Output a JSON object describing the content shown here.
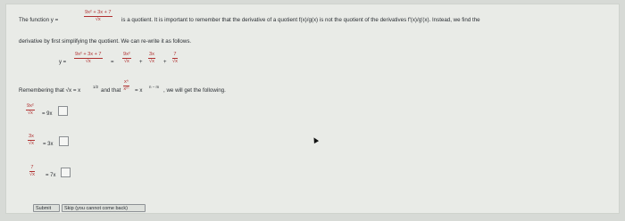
{
  "intro": {
    "prefix": "The function y =",
    "num": "9x² + 3x + 7",
    "den": "√x",
    "suffix": "is a quotient. It is important to remember that the derivative of a quotient f(x)/g(x) is not the quotient of the derivatives f′(x)/g′(x). Instead, we find the"
  },
  "line2": "derivative by first simplifying the quotient. We can re-write it as follows.",
  "eq1": {
    "lhs": "y =",
    "f1_num": "9x² + 3x + 7",
    "f1_den": "√x",
    "eq": "=",
    "f2_num": "9x²",
    "f2_den": "√x",
    "plus1": "+",
    "f3_num": "3x",
    "f3_den": "√x",
    "plus2": "+",
    "f4_num": "7",
    "f4_den": "√x"
  },
  "remember": {
    "a": "Remembering that √x = x",
    "a_exp": "1/2",
    "b": "and that",
    "frac_num": "xⁿ",
    "frac_den": "xᵐ",
    "c": "= x",
    "c_exp": "n − m",
    "d": ", we will get the following."
  },
  "rows": [
    {
      "num": "9x²",
      "den": "√x",
      "rhs": "= 9x"
    },
    {
      "num": "3x",
      "den": "√x",
      "rhs": "= 3x"
    },
    {
      "num": "7",
      "den": "√x",
      "rhs": "= 7x"
    }
  ],
  "buttons": {
    "submit": "Submit",
    "skip": "Skip (you cannot come back)"
  }
}
